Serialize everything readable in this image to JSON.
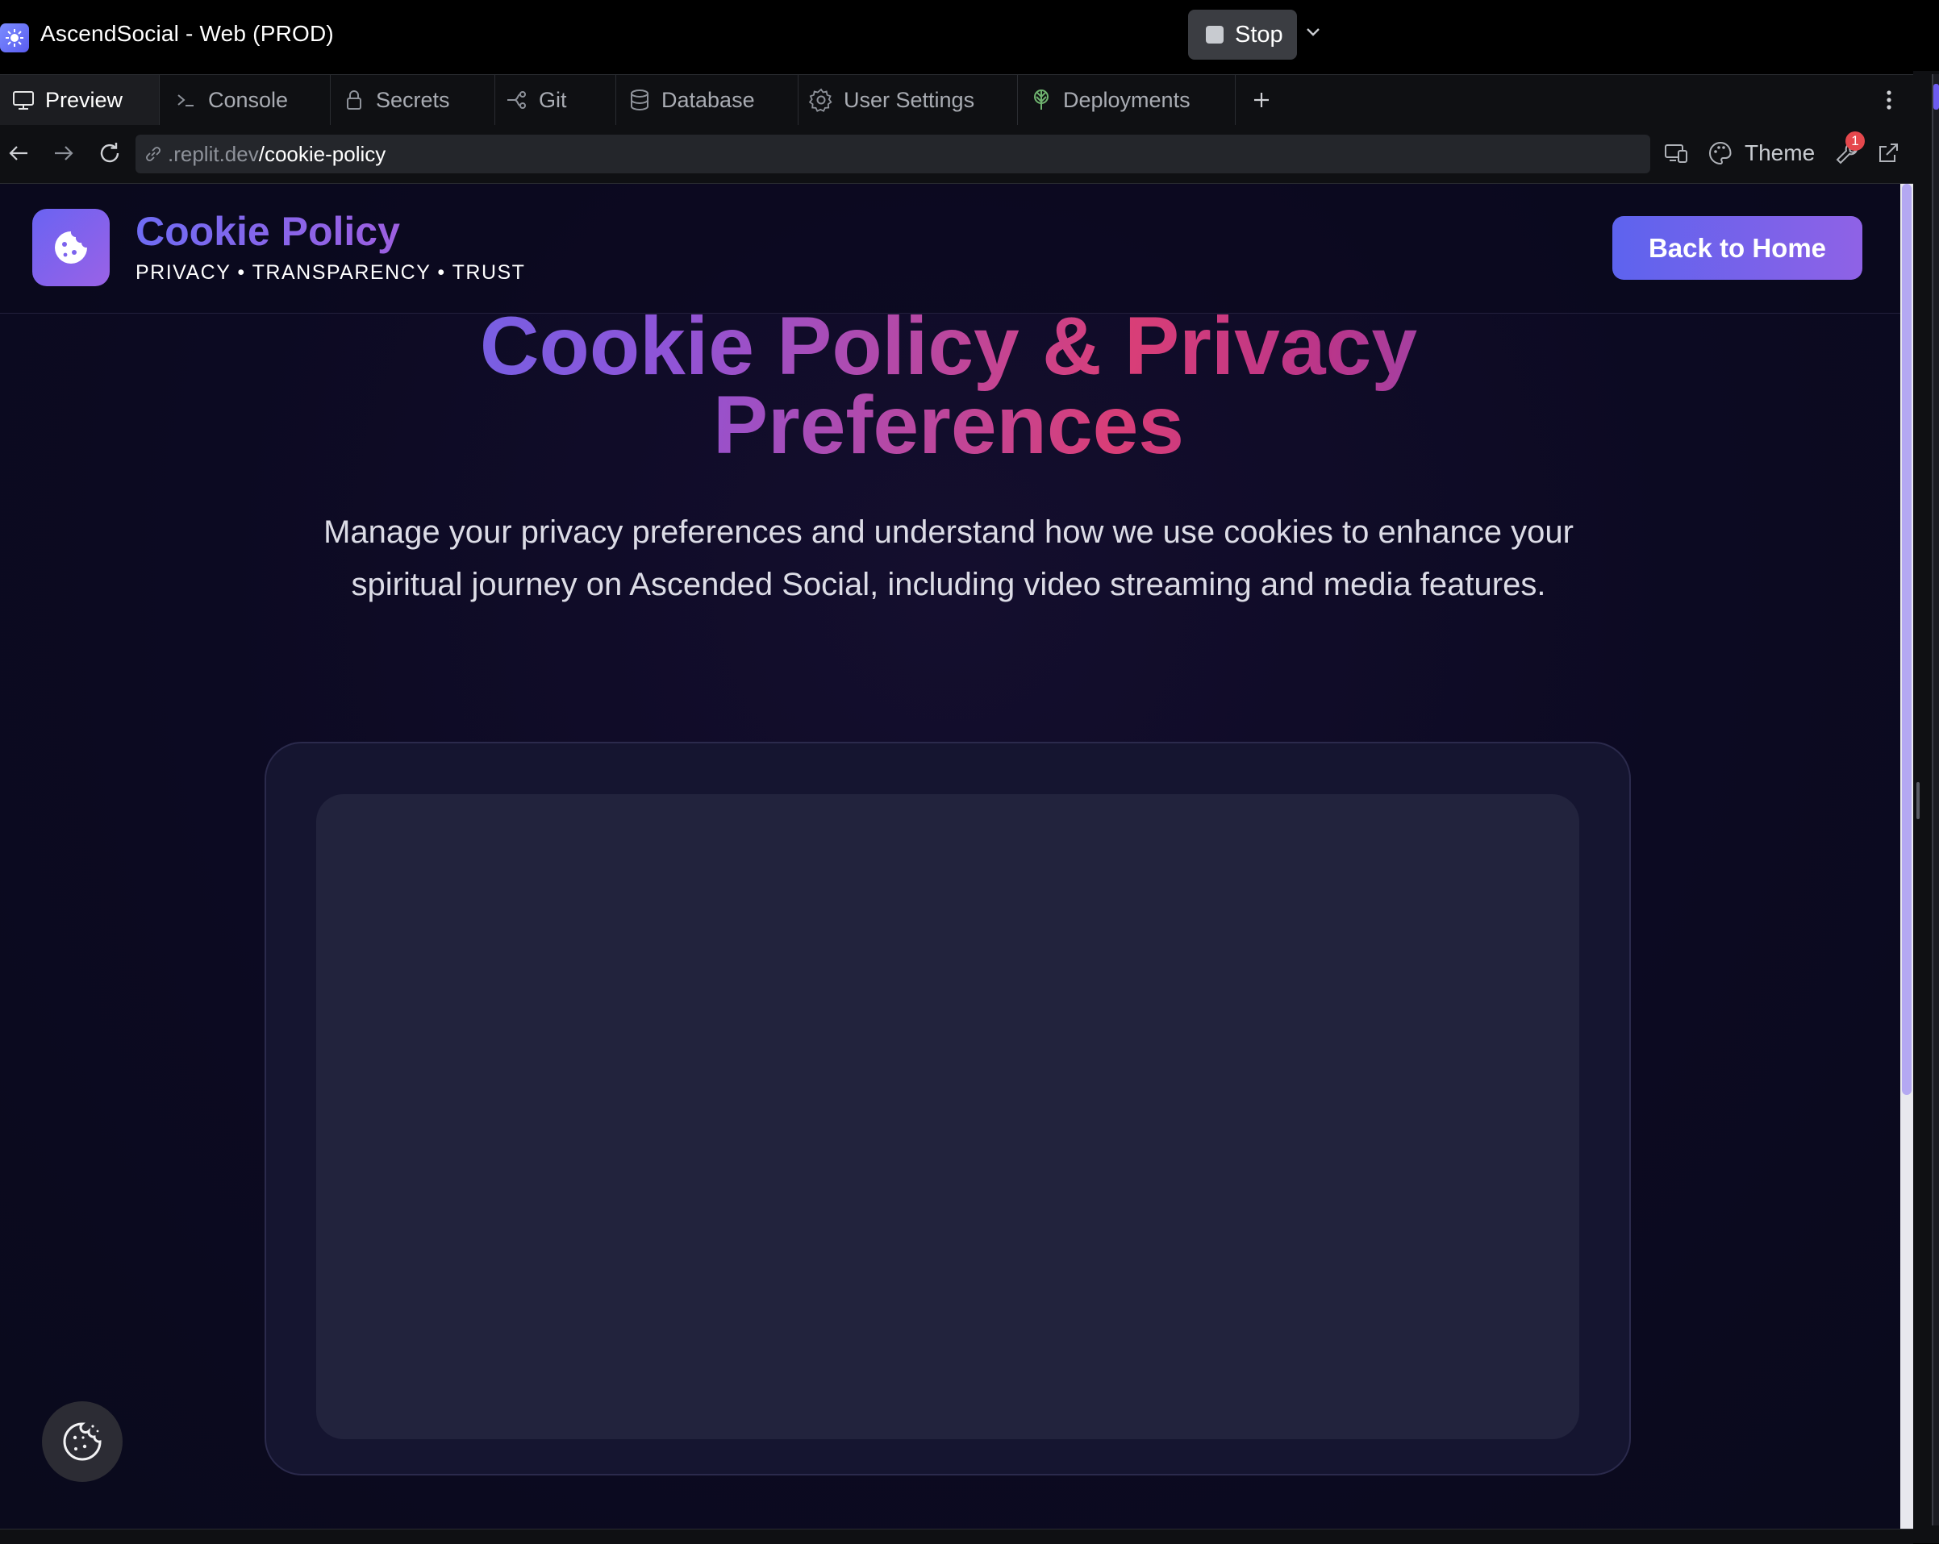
{
  "window": {
    "app_title": "AscendSocial - Web (PROD)",
    "stop_label": "Stop"
  },
  "tabs": [
    {
      "label": "Preview",
      "icon": "monitor-icon",
      "active": true
    },
    {
      "label": "Console",
      "icon": "terminal-icon",
      "active": false
    },
    {
      "label": "Secrets",
      "icon": "lock-icon",
      "active": false
    },
    {
      "label": "Git",
      "icon": "git-branch-icon",
      "active": false
    },
    {
      "label": "Database",
      "icon": "database-icon",
      "active": false
    },
    {
      "label": "User Settings",
      "icon": "gear-icon",
      "active": false
    },
    {
      "label": "Deployments",
      "icon": "deploy-icon",
      "active": false
    }
  ],
  "address": {
    "host": ".replit.dev",
    "path": "/cookie-policy",
    "theme_label": "Theme",
    "devtools_badge": "1"
  },
  "site": {
    "title": "Cookie Policy",
    "subtitle": "PRIVACY • TRANSPARENCY • TRUST",
    "back_button": "Back to Home",
    "hero_line1": "Cookie Policy & Privacy",
    "hero_line2": "Preferences",
    "description": "Manage your privacy preferences and understand how we use cookies to enhance your spiritual journey on Ascended Social, including video streaming and media features."
  },
  "colors": {
    "accent": "#6366f1",
    "accent_purple": "#8b5cf6",
    "accent_pink": "#db2777",
    "page_bg": "#0c0a22"
  }
}
